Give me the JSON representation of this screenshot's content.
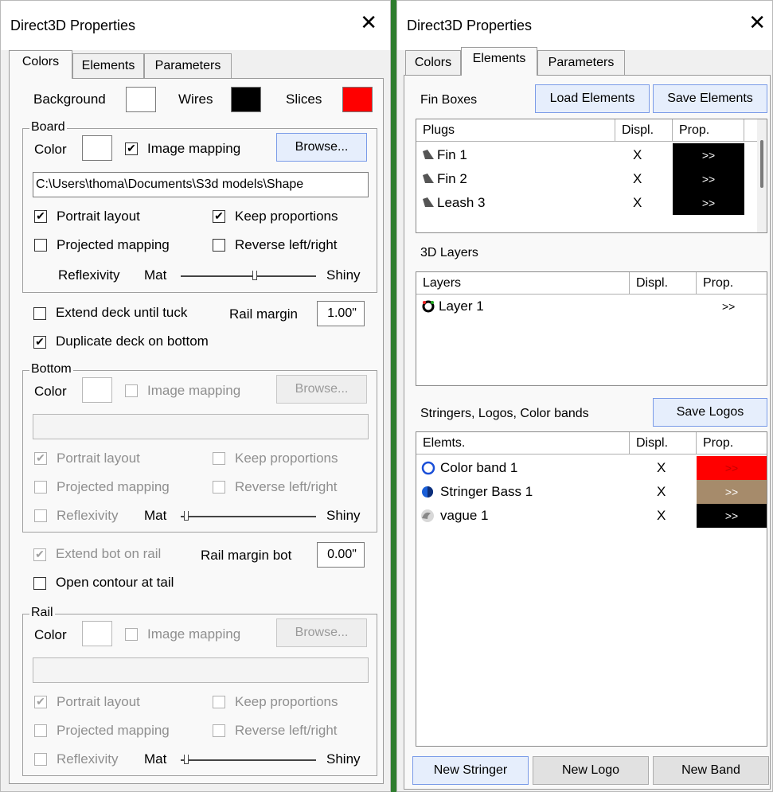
{
  "left": {
    "title": "Direct3D Properties",
    "close": "✕",
    "tabs": [
      "Colors",
      "Elements",
      "Parameters"
    ],
    "background_label": "Background",
    "wires_label": "Wires",
    "slices_label": "Slices",
    "colors": {
      "background": "#ffffff",
      "wires": "#000000",
      "slices": "#ff0000"
    },
    "board": {
      "group": "Board",
      "color_label": "Color",
      "image_mapping": "Image mapping",
      "browse": "Browse...",
      "path": "C:\\Users\\thoma\\Documents\\S3d models\\Shape",
      "portrait": "Portrait layout",
      "keep": "Keep proportions",
      "projected": "Projected mapping",
      "reverse": "Reverse left/right",
      "reflexivity": "Reflexivity",
      "mat": "Mat",
      "shiny": "Shiny"
    },
    "extend_deck": "Extend deck until tuck",
    "rail_margin_label": "Rail margin",
    "rail_margin_value": "1.00\"",
    "duplicate": "Duplicate deck on bottom",
    "bottom": {
      "group": "Bottom",
      "color_label": "Color",
      "image_mapping": "Image mapping",
      "browse": "Browse...",
      "portrait": "Portrait layout",
      "keep": "Keep proportions",
      "projected": "Projected mapping",
      "reverse": "Reverse left/right",
      "reflexivity": "Reflexivity",
      "mat": "Mat",
      "shiny": "Shiny"
    },
    "extend_bot": "Extend bot on rail",
    "rail_margin_bot_label": "Rail margin bot",
    "rail_margin_bot_value": "0.00\"",
    "open_contour": "Open contour at tail",
    "rail": {
      "group": "Rail",
      "color_label": "Color",
      "image_mapping": "Image mapping",
      "browse": "Browse...",
      "portrait": "Portrait layout",
      "keep": "Keep proportions",
      "projected": "Projected mapping",
      "reverse": "Reverse left/right",
      "reflexivity": "Reflexivity",
      "mat": "Mat",
      "shiny": "Shiny"
    },
    "check": "✔"
  },
  "right": {
    "title": "Direct3D Properties",
    "close": "✕",
    "tabs": [
      "Colors",
      "Elements",
      "Parameters"
    ],
    "fin_boxes": "Fin Boxes",
    "load_elements": "Load Elements",
    "save_elements": "Save Elements",
    "fin_cols": [
      "Plugs",
      "Displ.",
      "Prop."
    ],
    "fins": [
      {
        "name": "Fin 1",
        "displ": "X",
        "prop": ">>",
        "color": "#000000",
        "icon": "fin-icon"
      },
      {
        "name": "Fin 2",
        "displ": "X",
        "prop": ">>",
        "color": "#000000",
        "icon": "fin-icon"
      },
      {
        "name": "Leash 3",
        "displ": "X",
        "prop": ">>",
        "color": "#000000",
        "icon": "fin-icon"
      }
    ],
    "layers_title": "3D Layers",
    "layer_cols": [
      "Layers",
      "Displ.",
      "Prop."
    ],
    "layers": [
      {
        "name": "Layer 1",
        "prop": ">>",
        "icon": "layer-ring-icon"
      }
    ],
    "elems_title": "Stringers, Logos, Color bands",
    "save_logos": "Save Logos",
    "elem_cols": [
      "Elemts.",
      "Displ.",
      "Prop."
    ],
    "elems": [
      {
        "name": "Color band 1",
        "displ": "X",
        "prop": ">>",
        "color": "#ff0000",
        "textcolor": "#c00000",
        "icon": "color-band-ring-icon"
      },
      {
        "name": "Stringer Bass 1",
        "displ": "X",
        "prop": ">>",
        "color": "#a68b6b",
        "textcolor": "#ffffff",
        "icon": "stringer-sphere-icon"
      },
      {
        "name": "vague 1",
        "displ": "X",
        "prop": ">>",
        "color": "#000000",
        "textcolor": "#ffffff",
        "icon": "wave-icon"
      }
    ],
    "new_stringer": "New Stringer",
    "new_logo": "New Logo",
    "new_band": "New Band"
  }
}
